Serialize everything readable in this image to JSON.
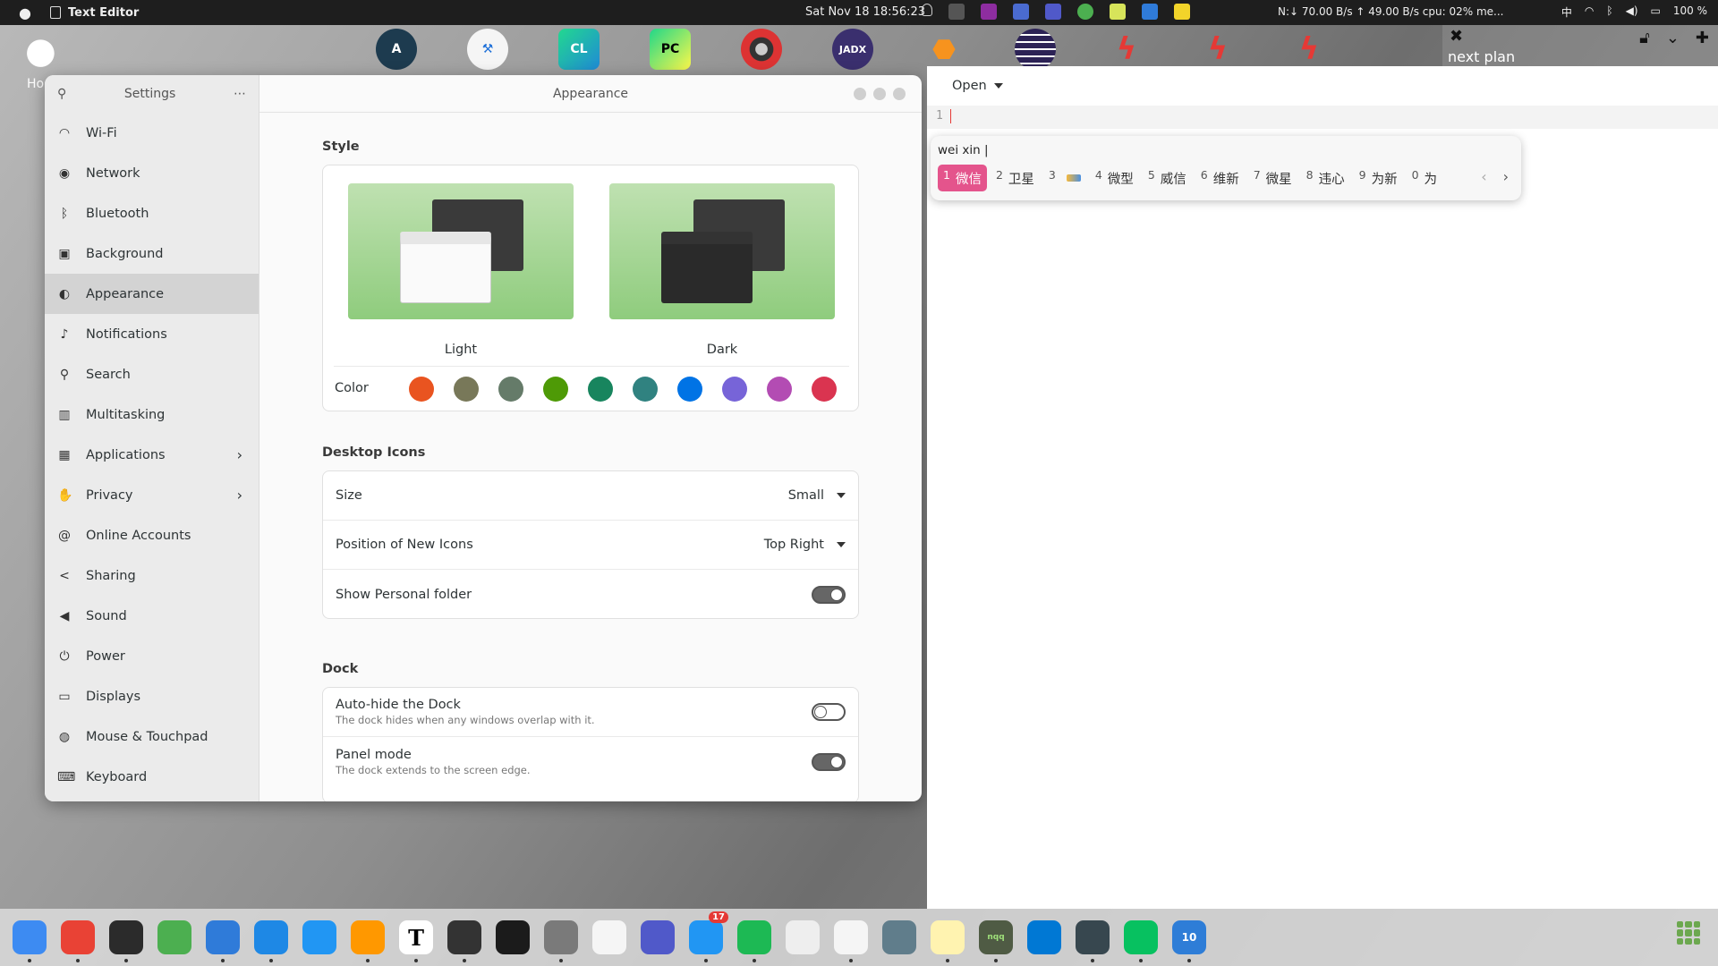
{
  "topbar": {
    "app_name": "Text Editor",
    "clock": "Sat Nov 18  18:56:23",
    "net": "N:↓  70.00 B/s ↑  49.00 B/s cpu: 02% me...",
    "input_method": "中",
    "battery": "100 %"
  },
  "desktop": {
    "home_label": "Ho",
    "next_plan": "next plan"
  },
  "launcher": {
    "items": [
      "Android Studio",
      "Xcode",
      "CLion",
      "PyCharm",
      "Disk Utility",
      "JADX",
      "Android",
      "Eclipse",
      "Flash 1",
      "Flash 2",
      "Flash 3"
    ],
    "labels": {
      "clion": "CL",
      "pycharm": "PC",
      "jadx": "JADX"
    }
  },
  "settings": {
    "sidebar_title": "Settings",
    "pane_title": "Appearance",
    "items": [
      {
        "label": "Wi-Fi",
        "icon": "wifi-icon"
      },
      {
        "label": "Network",
        "icon": "network-icon"
      },
      {
        "label": "Bluetooth",
        "icon": "bluetooth-icon"
      },
      {
        "label": "Background",
        "icon": "background-icon"
      },
      {
        "label": "Appearance",
        "icon": "appearance-icon"
      },
      {
        "label": "Notifications",
        "icon": "bell-icon"
      },
      {
        "label": "Search",
        "icon": "search-icon"
      },
      {
        "label": "Multitasking",
        "icon": "multitasking-icon"
      },
      {
        "label": "Applications",
        "icon": "grid-icon"
      },
      {
        "label": "Privacy",
        "icon": "hand-icon"
      },
      {
        "label": "Online Accounts",
        "icon": "at-icon"
      },
      {
        "label": "Sharing",
        "icon": "share-icon"
      },
      {
        "label": "Sound",
        "icon": "speaker-icon"
      },
      {
        "label": "Power",
        "icon": "power-icon"
      },
      {
        "label": "Displays",
        "icon": "display-icon"
      },
      {
        "label": "Mouse & Touchpad",
        "icon": "mouse-icon"
      },
      {
        "label": "Keyboard",
        "icon": "keyboard-icon"
      }
    ],
    "style": {
      "title": "Style",
      "light": "Light",
      "dark": "Dark",
      "color_label": "Color",
      "colors": [
        "#e95420",
        "#787859",
        "#657b69",
        "#4e9a06",
        "#18855e",
        "#308280",
        "#0073e5",
        "#7764d8",
        "#b34cb3",
        "#da3450"
      ]
    },
    "desktop_icons": {
      "title": "Desktop Icons",
      "size_label": "Size",
      "size_value": "Small",
      "position_label": "Position of New Icons",
      "position_value": "Top Right",
      "personal_label": "Show Personal folder",
      "personal_on": true
    },
    "dock": {
      "title": "Dock",
      "autohide_label": "Auto-hide the Dock",
      "autohide_sub": "The dock hides when any windows overlap with it.",
      "autohide_on": false,
      "panel_label": "Panel mode",
      "panel_sub": "The dock extends to the screen edge.",
      "panel_on": true
    }
  },
  "editor": {
    "open_label": "Open",
    "line_number": "1"
  },
  "ime": {
    "pinyin": "wei xin |",
    "candidates": [
      {
        "n": "1",
        "text": "微信"
      },
      {
        "n": "2",
        "text": "卫星"
      },
      {
        "n": "3",
        "text": ""
      },
      {
        "n": "4",
        "text": "微型"
      },
      {
        "n": "5",
        "text": "威信"
      },
      {
        "n": "6",
        "text": "维新"
      },
      {
        "n": "7",
        "text": "微星"
      },
      {
        "n": "8",
        "text": "违心"
      },
      {
        "n": "9",
        "text": "为新"
      },
      {
        "n": "0",
        "text": "为"
      }
    ]
  },
  "dock_bar": {
    "apps": [
      "Finder",
      "Chrome",
      "Terminal",
      "Browser",
      "Activity",
      "App Store",
      "Settings Gear",
      "Sublime",
      "Typora",
      "Disk Utility",
      "Monitor",
      "System Prefs",
      "Music",
      "Teams",
      "Mail",
      "Spotify",
      "Preview",
      "TextEdit",
      "Screenshot",
      "Notes",
      "NQQ",
      "Outlook",
      "Screen Capture",
      "WeChat",
      "Win10"
    ],
    "mail_badge": "17",
    "nqq_label": "nqq",
    "win_label": "10"
  }
}
